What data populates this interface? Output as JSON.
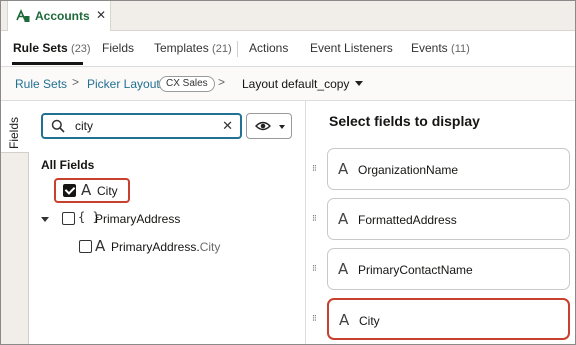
{
  "app_tab": {
    "title": "Accounts",
    "close": "✕",
    "icon": "app-logo-icon"
  },
  "nav_tabs": [
    {
      "label": "Rule Sets",
      "count": "(23)",
      "active": true
    },
    {
      "label": "Fields",
      "count": ""
    },
    {
      "label": "Templates",
      "count": "(21)"
    },
    {
      "label": "Actions",
      "count": ""
    },
    {
      "label": "Event Listeners",
      "count": ""
    },
    {
      "label": "Events",
      "count": "(11)"
    }
  ],
  "breadcrumb": {
    "items": [
      "Rule Sets",
      "Picker Layout"
    ],
    "pill": "CX Sales",
    "current": "Layout default_copy",
    "separator": ">"
  },
  "rail": {
    "label": "Fields"
  },
  "search": {
    "value": "city",
    "clear": "✕"
  },
  "left": {
    "section_title": "All Fields",
    "tree": [
      {
        "type_icon": "A",
        "label": "City",
        "checked": true
      },
      {
        "type_icon": "{ }",
        "label": "PrimaryAddress",
        "checked": false,
        "expanded": true
      },
      {
        "type_icon": "A",
        "label_prefix": "PrimaryAddress.",
        "label_match": "City",
        "checked": false
      }
    ]
  },
  "right": {
    "title": "Select fields to display",
    "handle": "⁝⁝",
    "fields": [
      {
        "icon": "A",
        "label": "OrganizationName"
      },
      {
        "icon": "A",
        "label": "FormattedAddress"
      },
      {
        "icon": "A",
        "label": "PrimaryContactName"
      },
      {
        "icon": "A",
        "label": "City"
      }
    ]
  },
  "colors": {
    "accent_green": "#1f6a3a",
    "link_blue": "#227093",
    "highlight_red": "#c8412f"
  }
}
